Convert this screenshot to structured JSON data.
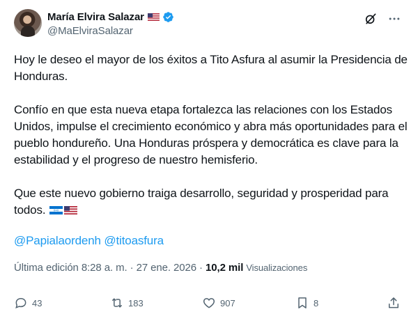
{
  "author": {
    "display_name": "María Elvira Salazar",
    "handle": "@MaElviraSalazar",
    "badge": "verified-badge-icon"
  },
  "post": {
    "paragraph1": "Hoy le deseo el mayor de los éxitos a Tito Asfura al asumir la Presidencia de Honduras.",
    "paragraph2": "Confío en que esta nueva etapa fortalezca las relaciones con los Estados Unidos, impulse el crecimiento económico y abra más oportunidades para el pueblo hondureño. Una Honduras próspera y democrática es clave para la estabilidad y el progreso de nuestro hemisferio.",
    "paragraph3": "Que este nuevo gobierno traiga desarrollo, seguridad y prosperidad para todos.",
    "mention1": "@Papialaordenh",
    "mention2": "@titoasfura"
  },
  "meta": {
    "edited_label": "Última edición 8:28 a. m. · 27 ene. 2026 ·",
    "views_count": "10,2 mil",
    "views_label": "Visualizaciones"
  },
  "actions": {
    "replies": "43",
    "reposts": "183",
    "likes": "907",
    "bookmarks": "8"
  },
  "colors": {
    "text": "#0f1419",
    "secondary": "#536471",
    "link": "#1d9bf0",
    "verified": "#1d9bf0"
  }
}
